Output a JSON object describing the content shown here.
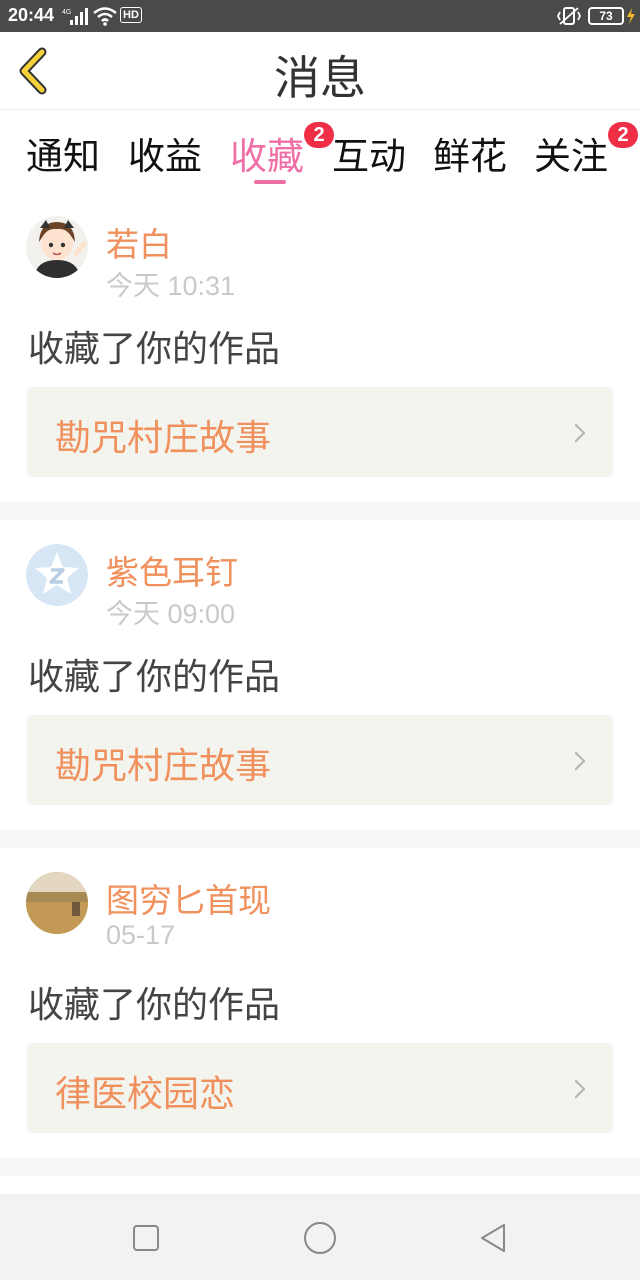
{
  "status_bar": {
    "time": "20:44",
    "signal_label": "4G",
    "hd_label": "HD",
    "battery": "73"
  },
  "header": {
    "title": "消息",
    "back_icon": "chevron-left-icon"
  },
  "tabs": [
    {
      "label": "通知"
    },
    {
      "label": "收益"
    },
    {
      "label": "收藏",
      "active": true,
      "badge": "2"
    },
    {
      "label": "互动"
    },
    {
      "label": "鲜花"
    },
    {
      "label": "关注",
      "badge": "2"
    }
  ],
  "messages": [
    {
      "user": "若白",
      "time": "今天 10:31",
      "action": "收藏了你的作品",
      "work": "勘咒村庄故事"
    },
    {
      "user": "紫色耳钉",
      "time": "今天 09:00",
      "action": "收藏了你的作品",
      "work": "勘咒村庄故事"
    },
    {
      "user": "图穷匕首现",
      "time": "05-17",
      "action": "收藏了你的作品",
      "work": "律医校园恋"
    }
  ],
  "colors": {
    "accent_pink": "#ef6fa6",
    "username_orange": "#f0905c",
    "badge_red": "#ee2f45",
    "back_arrow_yellow": "#f5d23a"
  },
  "nav": [
    "square-icon",
    "circle-icon",
    "triangle-back-icon"
  ]
}
